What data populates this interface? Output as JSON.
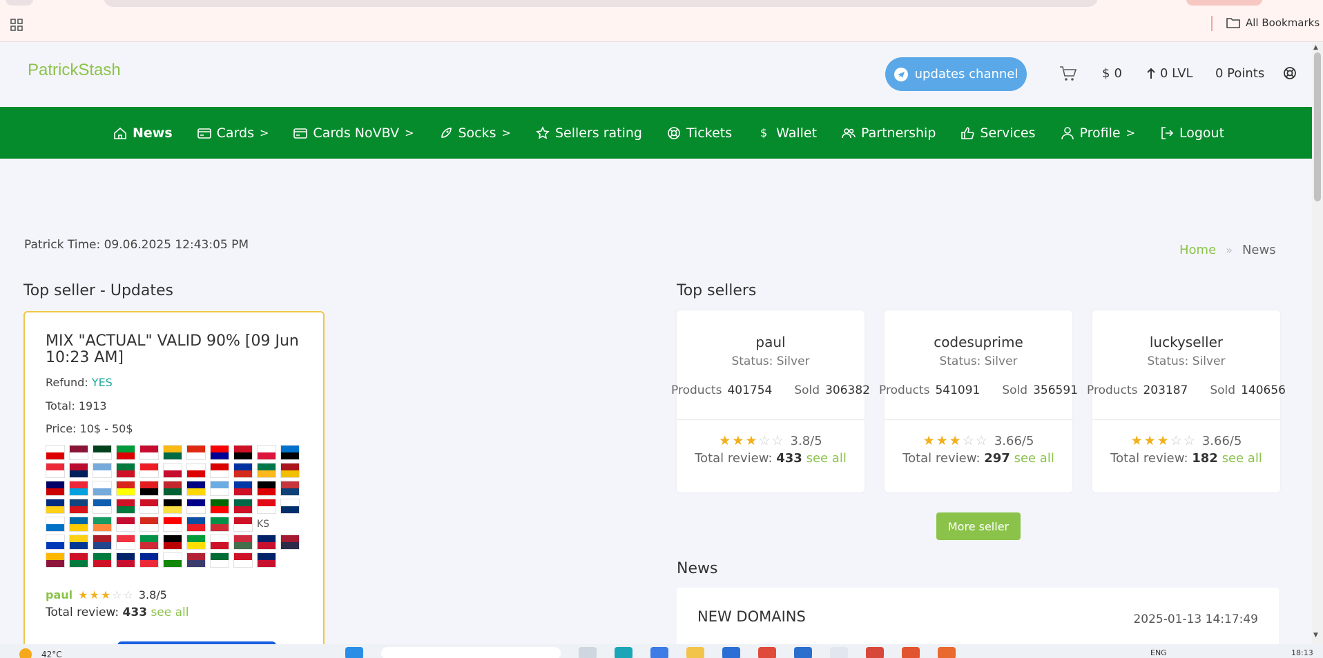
{
  "browser": {
    "bookmarks_label": "All Bookmarks"
  },
  "header": {
    "logo": "PatrickStash",
    "updates_label": "updates channel",
    "balance_symbol": "$",
    "balance": "0",
    "level": "0 LVL",
    "points": "0 Points"
  },
  "nav": [
    {
      "label": "News",
      "icon": "home-icon"
    },
    {
      "label": "Cards",
      "icon": "card-icon",
      "chevron": ">"
    },
    {
      "label": "Cards NoVBV",
      "icon": "card-icon",
      "chevron": ">"
    },
    {
      "label": "Socks",
      "icon": "rocket-icon",
      "chevron": ">"
    },
    {
      "label": "Sellers rating",
      "icon": "star-icon"
    },
    {
      "label": "Tickets",
      "icon": "lifebuoy-icon"
    },
    {
      "label": "Wallet",
      "icon": "dollar-icon"
    },
    {
      "label": "Partnership",
      "icon": "users-icon"
    },
    {
      "label": "Services",
      "icon": "thumbs-up-icon"
    },
    {
      "label": "Profile",
      "icon": "user-icon",
      "chevron": ">"
    },
    {
      "label": "Logout",
      "icon": "logout-icon"
    }
  ],
  "time": "Patrick Time: 09.06.2025 12:43:05 PM",
  "breadcrumb": {
    "home": "Home",
    "sep": "»",
    "current": "News"
  },
  "updates": {
    "section_title": "Top seller - Updates",
    "card_title": "MIX \"ACTUAL\" VALID 90% [09 Jun 10:23 AM]",
    "refund_label": "Refund:",
    "refund_value": "YES",
    "total": "Total: 1913",
    "price": "Price: 10$ - 50$",
    "broken_flag_alt": "KS",
    "seller": "paul",
    "rating": "3.8/5",
    "review_label": "Total review:",
    "review_count": "433",
    "see_all": "see all"
  },
  "top_sellers": {
    "section_title": "Top sellers",
    "products_label": "Products",
    "sold_label": "Sold",
    "review_label": "Total review:",
    "see_all": "see all",
    "sellers": [
      {
        "name": "paul",
        "status": "Status: Silver",
        "products": "401754",
        "sold": "306382",
        "rating": "3.8/5",
        "stars": 3,
        "reviews": "433"
      },
      {
        "name": "codesuprime",
        "status": "Status: Silver",
        "products": "541091",
        "sold": "356591",
        "rating": "3.66/5",
        "stars": 3,
        "reviews": "297"
      },
      {
        "name": "luckyseller",
        "status": "Status: Silver",
        "products": "203187",
        "sold": "140656",
        "rating": "3.66/5",
        "stars": 3,
        "reviews": "182"
      }
    ],
    "more_label": "More seller"
  },
  "news": {
    "section_title": "News",
    "items": [
      {
        "title": "NEW DOMAINS",
        "date": "2025-01-13 14:17:49"
      }
    ]
  },
  "taskbar": {
    "temp": "42°C",
    "lang": "ENG",
    "clock": "18:13"
  },
  "colors": {
    "brand_green": "#068b2c",
    "accent_green": "#8bc34a",
    "updates_blue": "#5aa8e8",
    "card_border": "#f0c64a",
    "star": "#f2b01e"
  }
}
